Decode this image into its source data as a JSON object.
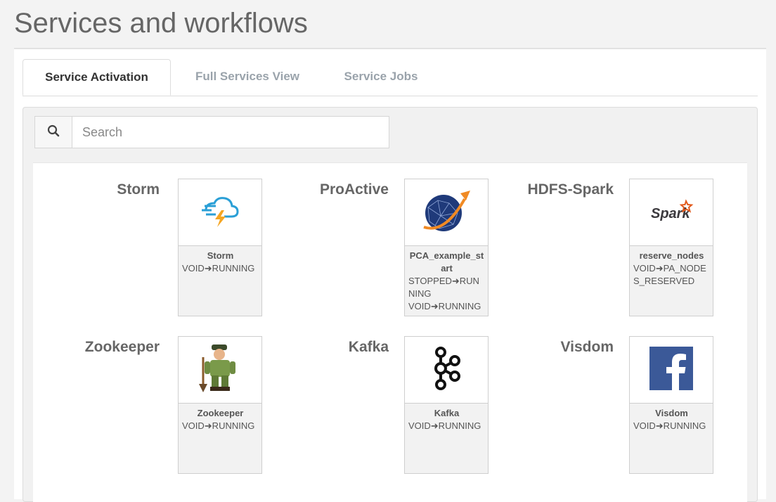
{
  "page": {
    "title": "Services and workflows"
  },
  "tabs": [
    {
      "label": "Service Activation",
      "active": true
    },
    {
      "label": "Full Services View",
      "active": false
    },
    {
      "label": "Service Jobs",
      "active": false
    }
  ],
  "search": {
    "placeholder": "Search",
    "value": ""
  },
  "services": [
    {
      "group": "Storm",
      "name": "Storm",
      "icon": "storm-logo-icon",
      "states": [
        "VOID➜RUNNING"
      ]
    },
    {
      "group": "ProActive",
      "name": "PCA_example_start",
      "icon": "proactive-globe-icon",
      "states": [
        "STOPPED➜RUNNING",
        "VOID➜RUNNING"
      ]
    },
    {
      "group": "HDFS-Spark",
      "name": "reserve_nodes",
      "icon": "spark-logo-icon",
      "states": [
        "VOID➜PA_NODES_RESERVED"
      ]
    },
    {
      "group": "Zookeeper",
      "name": "Zookeeper",
      "icon": "zookeeper-icon",
      "states": [
        "VOID➜RUNNING"
      ]
    },
    {
      "group": "Kafka",
      "name": "Kafka",
      "icon": "kafka-logo-icon",
      "states": [
        "VOID➜RUNNING"
      ]
    },
    {
      "group": "Visdom",
      "name": "Visdom",
      "icon": "facebook-logo-icon",
      "states": [
        "VOID➜RUNNING"
      ]
    }
  ],
  "colors": {
    "accent": "#555555",
    "facebook": "#3b5998",
    "proactive_blue": "#1f3a7a",
    "proactive_orange": "#f08a24"
  }
}
